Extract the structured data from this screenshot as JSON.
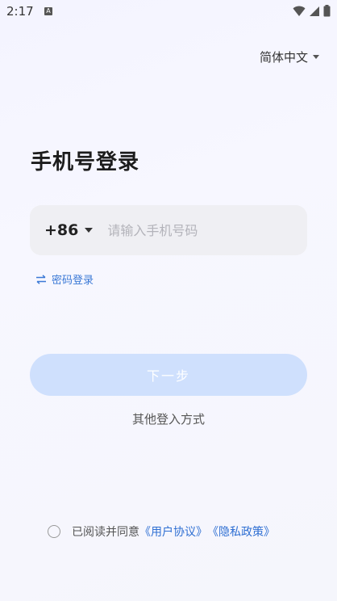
{
  "status_bar": {
    "time": "2:17",
    "a_glyph": "A"
  },
  "language": {
    "label": "简体中文"
  },
  "title": "手机号登录",
  "phone": {
    "country_code": "+86",
    "placeholder": "请输入手机号码"
  },
  "password_login": {
    "label": "密码登录",
    "icon": "swap-arrows-icon"
  },
  "next_button": {
    "label": "下一步"
  },
  "other_login": {
    "label": "其他登入方式"
  },
  "agreement": {
    "prefix": "已阅读并同意",
    "user_agreement": "《用户协议》",
    "privacy_policy": "《隐私政策》"
  },
  "colors": {
    "accent": "#3b79d6",
    "button_disabled": "#cfe0fd",
    "input_bg": "#efeff3"
  }
}
